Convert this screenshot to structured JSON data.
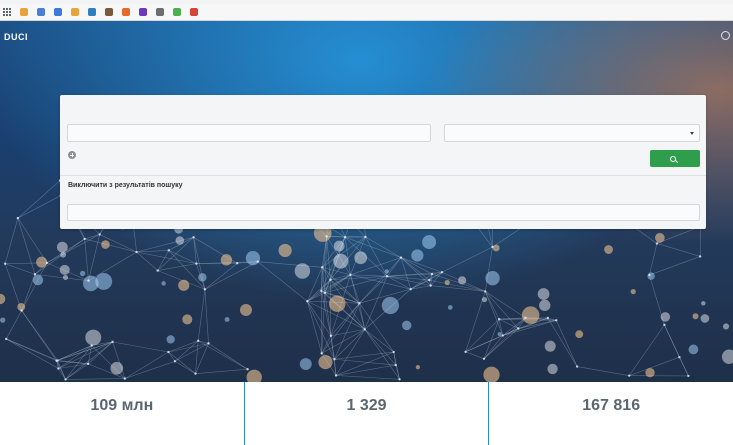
{
  "browser": {
    "bookmarks": [
      {
        "label": "",
        "color": "#5f6368"
      },
      {
        "label": "",
        "color": "#e8a33d"
      },
      {
        "label": "",
        "color": "#4a7fd6"
      },
      {
        "label": "",
        "color": "#3c7bd8"
      },
      {
        "label": "",
        "color": "#e8a33d"
      },
      {
        "label": "",
        "color": "#2d7fc0"
      },
      {
        "label": "",
        "color": "#7a5a3a"
      },
      {
        "label": "",
        "color": "#e26a2c"
      },
      {
        "label": "",
        "color": "#6a3ab8"
      },
      {
        "label": "",
        "color": "#6d6d6d"
      },
      {
        "label": "",
        "color": "#4caf50"
      },
      {
        "label": "",
        "color": "#d44638"
      }
    ]
  },
  "header": {
    "logo": "DUCI",
    "nav": [
      "",
      "",
      ""
    ]
  },
  "search": {
    "hint": "",
    "input_placeholder": "",
    "field_select": "",
    "add_label": "",
    "button_label": "",
    "exclude_title": "Виключити з результатів пошуку",
    "exclude_hint": "",
    "exclude_placeholder": ""
  },
  "stats": [
    {
      "value": "109 млн",
      "label": ""
    },
    {
      "value": "1 329",
      "label": ""
    },
    {
      "value": "167 816",
      "label": ""
    }
  ]
}
